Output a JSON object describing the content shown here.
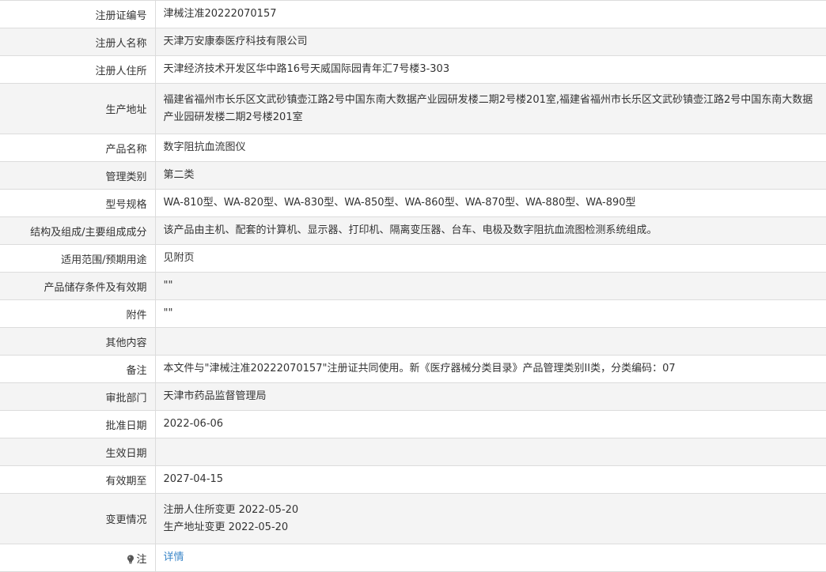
{
  "rows": [
    {
      "label": "注册证编号",
      "value": "津械注准20222070157"
    },
    {
      "label": "注册人名称",
      "value": "天津万安康泰医疗科技有限公司"
    },
    {
      "label": "注册人住所",
      "value": "天津经济技术开发区华中路16号天威国际园青年汇7号楼3-303"
    },
    {
      "label": "生产地址",
      "value": "福建省福州市长乐区文武砂镇壶江路2号中国东南大数据产业园研发楼二期2号楼201室,福建省福州市长乐区文武砂镇壶江路2号中国东南大数据产业园研发楼二期2号楼201室"
    },
    {
      "label": "产品名称",
      "value": "数字阻抗血流图仪"
    },
    {
      "label": "管理类别",
      "value": "第二类"
    },
    {
      "label": "型号规格",
      "value": "WA-810型、WA-820型、WA-830型、WA-850型、WA-860型、WA-870型、WA-880型、WA-890型"
    },
    {
      "label": "结构及组成/主要组成成分",
      "value": "该产品由主机、配套的计算机、显示器、打印机、隔离变压器、台车、电极及数字阻抗血流图检测系统组成。"
    },
    {
      "label": "适用范围/预期用途",
      "value": "见附页"
    },
    {
      "label": "产品储存条件及有效期",
      "value": "\"\""
    },
    {
      "label": "附件",
      "value": "\"\""
    },
    {
      "label": "其他内容",
      "value": ""
    },
    {
      "label": "备注",
      "value": "本文件与\"津械注准20222070157\"注册证共同使用。新《医疗器械分类目录》产品管理类别II类，分类编码：07"
    },
    {
      "label": "审批部门",
      "value": "天津市药品监督管理局"
    },
    {
      "label": "批准日期",
      "value": "2022-06-06"
    },
    {
      "label": "生效日期",
      "value": ""
    },
    {
      "label": "有效期至",
      "value": "2027-04-15"
    },
    {
      "label": "变更情况",
      "lines": [
        "注册人住所变更 2022-05-20",
        "生产地址变更 2022-05-20"
      ]
    },
    {
      "label": "注",
      "icon": "lightbulb-icon",
      "link_text": "详情"
    }
  ],
  "colors": {
    "border": "#dcdcdc",
    "alt_row": "#f4f4f4",
    "link": "#3a86c8",
    "text": "#333333"
  }
}
